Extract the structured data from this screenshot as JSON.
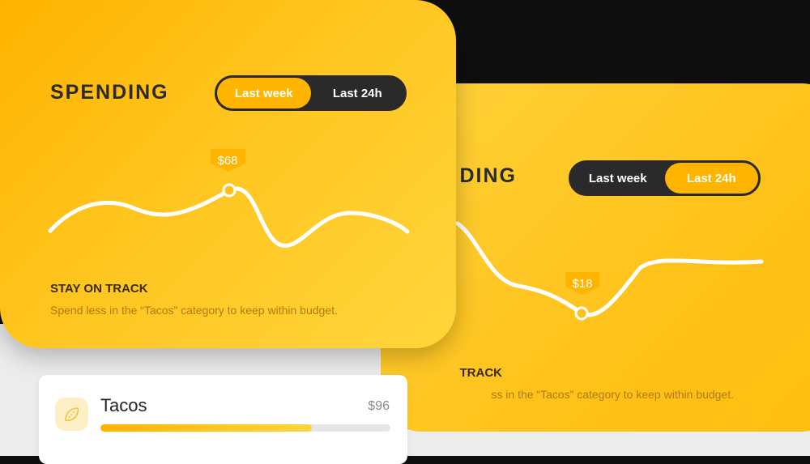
{
  "colors": {
    "accent": "#ffb400",
    "card_yellow": "#ffc722",
    "toggle_dark": "#2a2a2a",
    "line": "#ffffff"
  },
  "back_card": {
    "title": "DING",
    "toggle": {
      "option_1": "Last week",
      "option_2": "Last 24h",
      "active": "Last 24h"
    },
    "tooltip": "$18",
    "track_title": "TRACK",
    "track_desc": "ss in the “Tacos” category to keep within budget."
  },
  "front_card": {
    "title": "SPENDING",
    "toggle": {
      "option_1": "Last week",
      "option_2": "Last 24h",
      "active": "Last week"
    },
    "tooltip": "$68",
    "track_title": "STAY ON TRACK",
    "track_desc": "Spend less in the “Tacos” category to keep within budget."
  },
  "list": {
    "items": [
      {
        "name": "Tacos",
        "amount": "$96",
        "icon": "taco-icon",
        "progress_percent": 73
      }
    ]
  }
}
